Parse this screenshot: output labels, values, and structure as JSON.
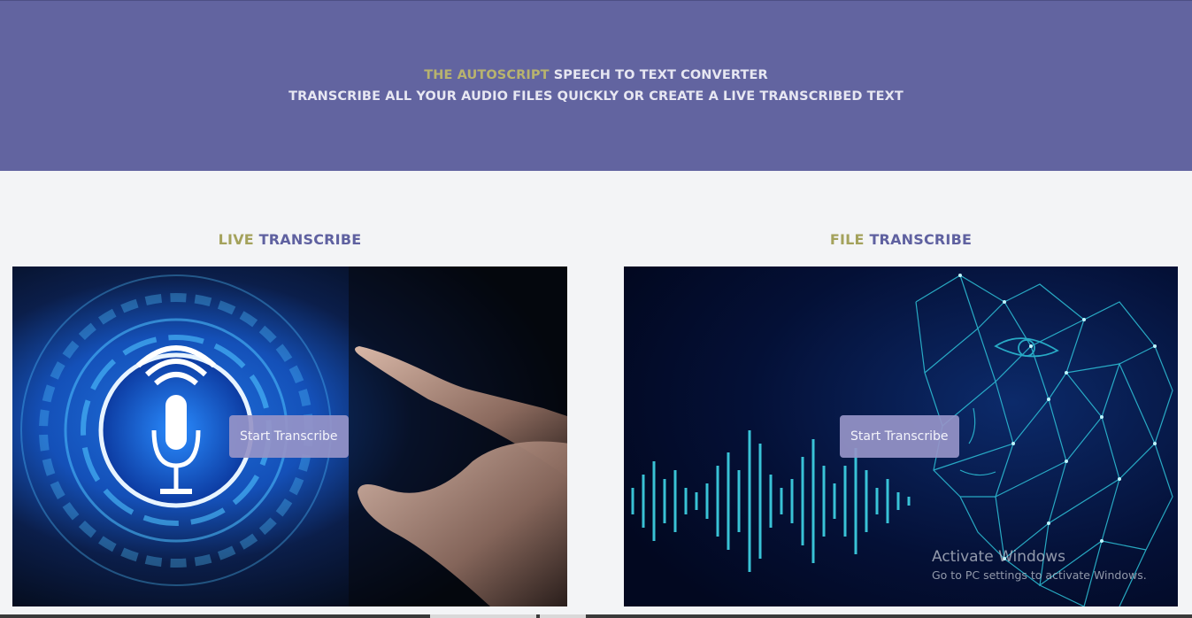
{
  "header": {
    "line1_accent": "THE AUTOSCRIPT",
    "line1_rest": " SPEECH TO TEXT CONVERTER",
    "line2": "TRANSCRIBE ALL YOUR AUDIO FILES QUICKLY OR CREATE A LIVE TRANSCRIBED TEXT"
  },
  "live": {
    "title_accent": "LIVE",
    "title_rest": " TRANSCRIBE",
    "button_label": "Start Transcribe",
    "image_icon": "microphone-icon"
  },
  "file": {
    "title_accent": "FILE",
    "title_rest": " TRANSCRIBE",
    "button_label": "Start Transcribe",
    "image_icon": "sound-wave-icon"
  },
  "watermark": {
    "title": "Activate Windows",
    "subtitle": "Go to PC settings to activate Windows."
  },
  "colors": {
    "header_bg": "#6264a0",
    "accent_text": "#b8b36e",
    "title_text": "#5f61a0",
    "button_bg": "#9694c8"
  }
}
